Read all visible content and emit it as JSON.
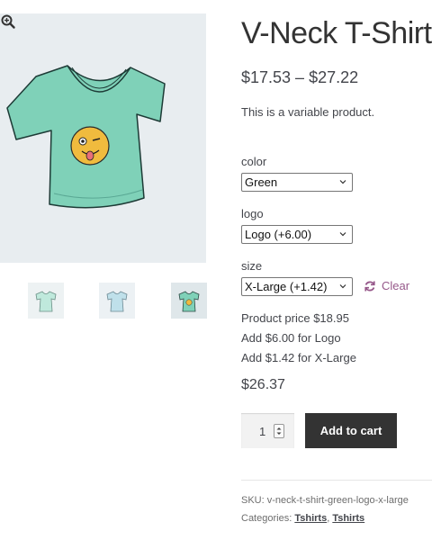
{
  "product": {
    "title": "V-Neck T-Shirt",
    "price_range": "$17.53 – $27.22",
    "description": "This is a variable product."
  },
  "variations": [
    {
      "label": "color",
      "selected": "Green"
    },
    {
      "label": "logo",
      "selected": "Logo (+6.00)"
    },
    {
      "label": "size",
      "selected": "X-Large (+1.42)"
    }
  ],
  "clear_label": "Clear",
  "breakdown": {
    "line1": "Product price $18.95",
    "line2": "Add $6.00 for Logo",
    "line3": "Add $1.42 for X-Large"
  },
  "total_price": "$26.37",
  "quantity": "1",
  "add_to_cart_label": "Add to cart",
  "meta": {
    "sku_label": "SKU:",
    "sku_value": "v-neck-t-shirt-green-logo-x-large",
    "categories_label": "Categories:",
    "categories": [
      "Tshirts",
      "Tshirts"
    ],
    "separator": ","
  },
  "icons": {
    "zoom": "magnifier-plus-icon",
    "clear": "refresh-icon",
    "select": "chevron-down-icon"
  },
  "colors": {
    "shirt_green": "#7fd1b8",
    "shirt_teal": "#6cbfa9",
    "link_purple": "#96588a",
    "button_dark": "#333333",
    "gallery_bg": "#e8edf0"
  }
}
